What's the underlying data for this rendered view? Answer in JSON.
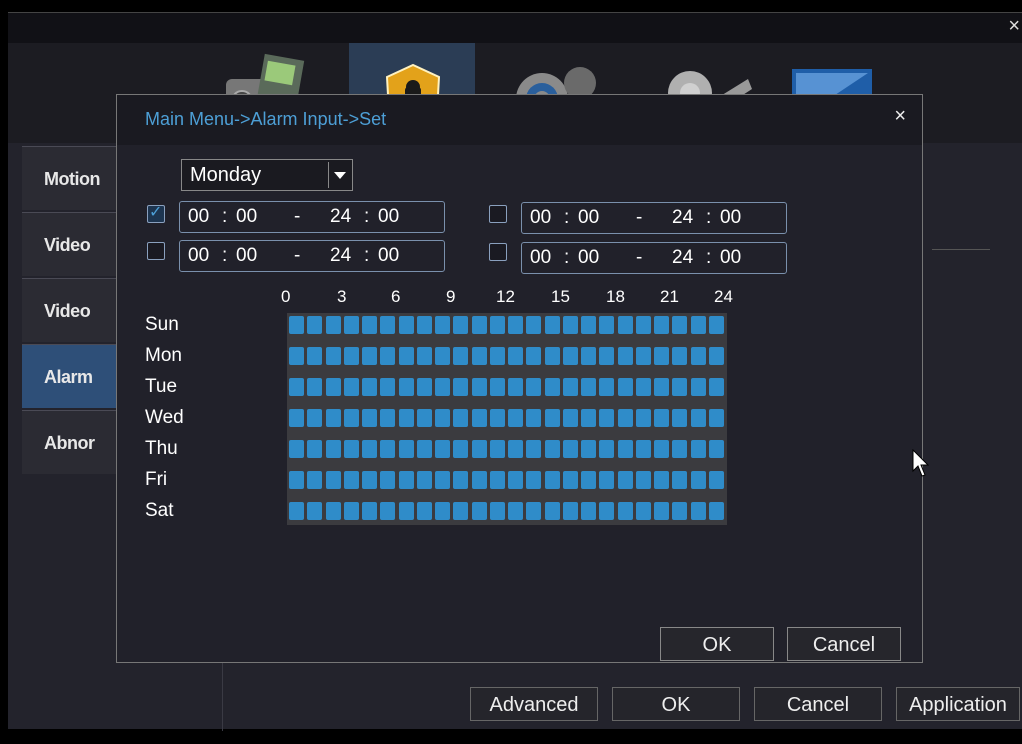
{
  "outer": {
    "close_glyph": "×",
    "top_icons": [
      "record-icon",
      "alarm-shield-icon",
      "system-gears-icon",
      "tools-icon",
      "info-monitor-icon"
    ],
    "side_tabs": [
      {
        "label": "Motion"
      },
      {
        "label": "Video"
      },
      {
        "label": "Video"
      },
      {
        "label": "Alarm"
      },
      {
        "label": "Abnor"
      }
    ],
    "buttons": {
      "advanced": "Advanced",
      "ok": "OK",
      "cancel": "Cancel",
      "application": "Application"
    }
  },
  "dialog": {
    "title": "Main Menu->Alarm Input->Set",
    "close_glyph": "×",
    "day_selected": "Monday",
    "periods": [
      {
        "checked": true,
        "start_h": "00",
        "start_m": "00",
        "end_h": "24",
        "end_m": "00"
      },
      {
        "checked": false,
        "start_h": "00",
        "start_m": "00",
        "end_h": "24",
        "end_m": "00"
      },
      {
        "checked": false,
        "start_h": "00",
        "start_m": "00",
        "end_h": "24",
        "end_m": "00"
      },
      {
        "checked": false,
        "start_h": "00",
        "start_m": "00",
        "end_h": "24",
        "end_m": "00"
      }
    ],
    "hour_labels": [
      "0",
      "3",
      "6",
      "9",
      "12",
      "15",
      "18",
      "21",
      "24"
    ],
    "weekdays": [
      "Sun",
      "Mon",
      "Tue",
      "Wed",
      "Thu",
      "Fri",
      "Sat"
    ],
    "schedule_all_hours_enabled": true,
    "ok_label": "OK",
    "cancel_label": "Cancel"
  },
  "colors": {
    "accent": "#4d9fd6",
    "cell": "#2f8cc9",
    "active_tab": "#2e4f78"
  }
}
